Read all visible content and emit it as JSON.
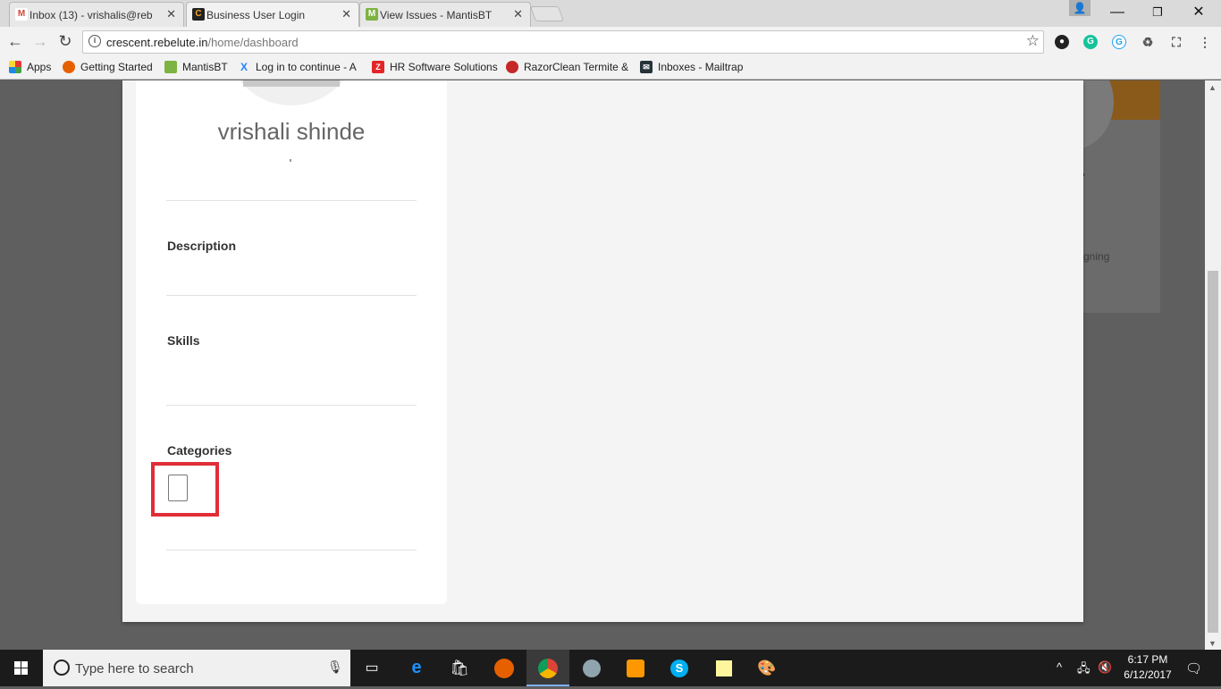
{
  "tabs": [
    {
      "title": "Inbox (13) - vrishalis@reb",
      "icon": "gmail-icon",
      "active": false
    },
    {
      "title": "Business User Login",
      "icon": "crescent-icon",
      "active": true
    },
    {
      "title": "View Issues - MantisBT",
      "icon": "mantis-icon",
      "active": false
    }
  ],
  "window_controls": {
    "minimize": "—",
    "maximize": "❐",
    "close": "✕"
  },
  "address_bar": {
    "domain": "crescent.rebelute.in",
    "path": "/home/dashboard"
  },
  "bookmarks": [
    {
      "label": "Apps",
      "icon": "apps-grid-icon"
    },
    {
      "label": "Getting Started",
      "icon": "firefox-icon"
    },
    {
      "label": "MantisBT",
      "icon": "mantis-icon"
    },
    {
      "label": "Log in to continue - A",
      "icon": "atlassian-icon"
    },
    {
      "label": "HR Software Solutions",
      "icon": "zoho-icon"
    },
    {
      "label": "RazorClean Termite &",
      "icon": "razorclean-icon"
    },
    {
      "label": "Inboxes - Mailtrap",
      "icon": "mailtrap-icon"
    }
  ],
  "profile": {
    "name": "vrishali shinde",
    "sections": {
      "description": "Description",
      "skills": "Skills",
      "categories": "Categories"
    }
  },
  "background": {
    "partial_text": "gning"
  },
  "taskbar": {
    "search_placeholder": "Type here to search",
    "time": "6:17 PM",
    "date": "6/12/2017"
  },
  "colors": {
    "highlight": "#e12d38",
    "modal_bg": "#f4f4f4",
    "overlay": "#5f5f5f"
  }
}
